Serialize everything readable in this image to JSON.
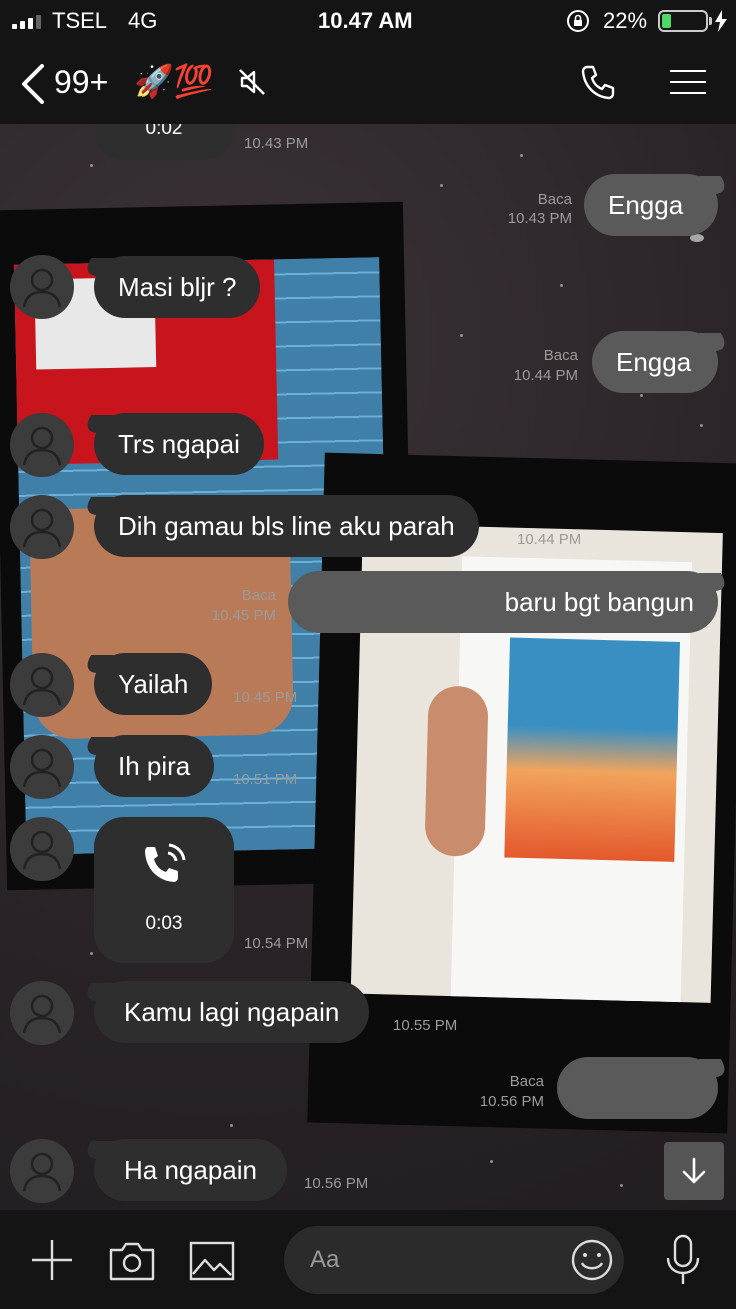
{
  "status_bar": {
    "carrier": "TSEL",
    "network": "4G",
    "time": "10.47 AM",
    "battery_percent": "22%",
    "battery_level": 0.22
  },
  "header": {
    "back_count": "99+",
    "chat_name_emoji": "🚀💯",
    "icons": [
      "chevron-left-icon",
      "mute-icon",
      "phone-icon",
      "menu-icon"
    ]
  },
  "messages": [
    {
      "side": "in",
      "type": "call",
      "duration": "0:02",
      "time": "10.43 PM"
    },
    {
      "side": "out",
      "text": "Engga",
      "read": "Baca",
      "time": "10.43 PM"
    },
    {
      "side": "in",
      "text": "Masi bljr ?",
      "time": ""
    },
    {
      "side": "out",
      "text": "Engga",
      "read": "Baca",
      "time": "10.44 PM"
    },
    {
      "side": "in",
      "text": "Trs ngapai",
      "time": ""
    },
    {
      "side": "in",
      "text": "Dih gamau bls line aku parah",
      "time": "10.44 PM"
    },
    {
      "side": "out",
      "text": "baru bgt bangun",
      "read": "Baca",
      "time": "10.45 PM"
    },
    {
      "side": "in",
      "text": "Yailah",
      "time": "10.45 PM"
    },
    {
      "side": "in",
      "text": "Ih pira",
      "time": "10.51 PM"
    },
    {
      "side": "in",
      "type": "call",
      "duration": "0:03",
      "time": "10.54 PM"
    },
    {
      "side": "in",
      "text": "Kamu lagi ngapain",
      "time": "10.55 PM"
    },
    {
      "side": "out",
      "text": "",
      "read": "Baca",
      "time": "10.56 PM"
    },
    {
      "side": "in",
      "text": "Ha ngapain",
      "time": "10.56 PM"
    }
  ],
  "input_bar": {
    "placeholder": "Aa",
    "icons": [
      "plus-icon",
      "camera-icon",
      "image-icon",
      "emoji-icon",
      "microphone-icon"
    ]
  },
  "colors": {
    "bar_bg": "#141414",
    "incoming_bubble": "#2e2e2e",
    "outgoing_bubble": "#5a5a5a",
    "battery_green": "#4cd964"
  }
}
